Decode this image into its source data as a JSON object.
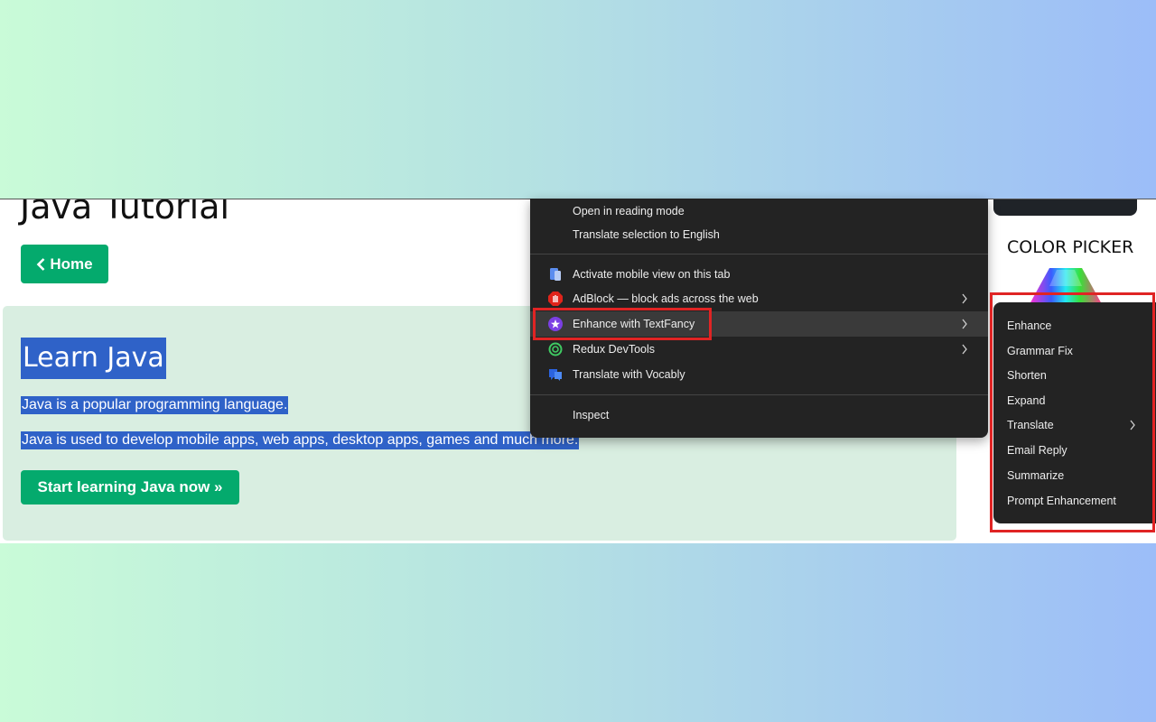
{
  "page": {
    "heading": "Java Tutorial",
    "home_button": "Home",
    "hero": {
      "title": "Learn Java",
      "paragraph1": "Java is a popular programming language.",
      "paragraph2": "Java is used to develop mobile apps, web apps, desktop apps, games and much more.",
      "cta_button": "Start learning Java now »"
    },
    "sidebar": {
      "color_picker_title": "COLOR PICKER"
    }
  },
  "context_menu": {
    "items": [
      {
        "label": "Open in reading mode",
        "icon": "none",
        "submenu": false
      },
      {
        "label": "Translate selection to English",
        "icon": "none",
        "submenu": false
      },
      {
        "label": "Activate mobile view on this tab",
        "icon": "mobile-view-icon",
        "submenu": false
      },
      {
        "label": "AdBlock — block ads across the web",
        "icon": "adblock-hand-icon",
        "submenu": true
      },
      {
        "label": "Enhance with TextFancy",
        "icon": "textfancy-star-icon",
        "submenu": true,
        "highlighted": true
      },
      {
        "label": "Redux DevTools",
        "icon": "redux-devtools-icon",
        "submenu": true
      },
      {
        "label": "Translate with Vocably",
        "icon": "vocably-icon",
        "submenu": false
      },
      {
        "label": "Inspect",
        "icon": "none",
        "submenu": false
      }
    ]
  },
  "submenu": {
    "items": [
      {
        "label": "Enhance",
        "submenu": false
      },
      {
        "label": "Grammar Fix",
        "submenu": false
      },
      {
        "label": "Shorten",
        "submenu": false
      },
      {
        "label": "Expand",
        "submenu": false
      },
      {
        "label": "Translate",
        "submenu": true
      },
      {
        "label": "Email Reply",
        "submenu": false
      },
      {
        "label": "Summarize",
        "submenu": false
      },
      {
        "label": "Prompt Enhancement",
        "submenu": false
      }
    ]
  },
  "colors": {
    "accent_green": "#04aa6d",
    "hero_background": "#d9eee1",
    "selection_blue": "#2f62c8",
    "menu_background": "#232323",
    "highlight_border": "#e02424"
  }
}
